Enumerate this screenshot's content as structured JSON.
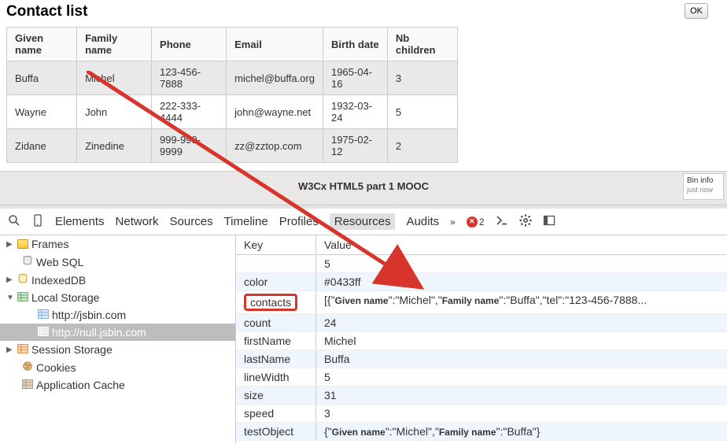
{
  "page": {
    "title": "Contact list",
    "ok": "OK"
  },
  "table": {
    "headers": [
      "Given name",
      "Family name",
      "Phone",
      "Email",
      "Birth date",
      "Nb children"
    ],
    "rows": [
      [
        "Buffa",
        "Michel",
        "123-456-7888",
        "michel@buffa.org",
        "1965-04-16",
        "3"
      ],
      [
        "Wayne",
        "John",
        "222-333-4444",
        "john@wayne.net",
        "1932-03-24",
        "5"
      ],
      [
        "Zidane",
        "Zinedine",
        "999-999-9999",
        "zz@zztop.com",
        "1975-02-12",
        "2"
      ]
    ]
  },
  "bin": {
    "title": "W3Cx HTML5 part 1 MOOC",
    "card": "Bin info",
    "cardSub": "just now"
  },
  "devtools": {
    "tabs": [
      "Elements",
      "Network",
      "Sources",
      "Timeline",
      "Profiles",
      "Resources",
      "Audits"
    ],
    "more": "»",
    "errCount": "2",
    "tree": {
      "frames": "Frames",
      "websql": "Web SQL",
      "indexed": "IndexedDB",
      "local": "Local Storage",
      "local_items": [
        "http://jsbin.com",
        "http://null.jsbin.com"
      ],
      "session": "Session Storage",
      "cookies": "Cookies",
      "appcache": "Application Cache"
    },
    "kvHead": {
      "k": "Key",
      "v": "Value"
    },
    "kv": [
      {
        "k": "",
        "v": "5"
      },
      {
        "k": "color",
        "v": "#0433ff"
      },
      {
        "k": "contacts",
        "v": "[{\"Given name\":\"Michel\",\"Family name\":\"Buffa\",\"tel\":\"123-456-7888..."
      },
      {
        "k": "count",
        "v": "24"
      },
      {
        "k": "firstName",
        "v": "Michel"
      },
      {
        "k": "lastName",
        "v": "Buffa"
      },
      {
        "k": "lineWidth",
        "v": "5"
      },
      {
        "k": "size",
        "v": "31"
      },
      {
        "k": "speed",
        "v": "3"
      },
      {
        "k": "testObject",
        "v": "{\"Given name\":\"Michel\",\"Family name\":\"Buffa\"}"
      }
    ]
  }
}
